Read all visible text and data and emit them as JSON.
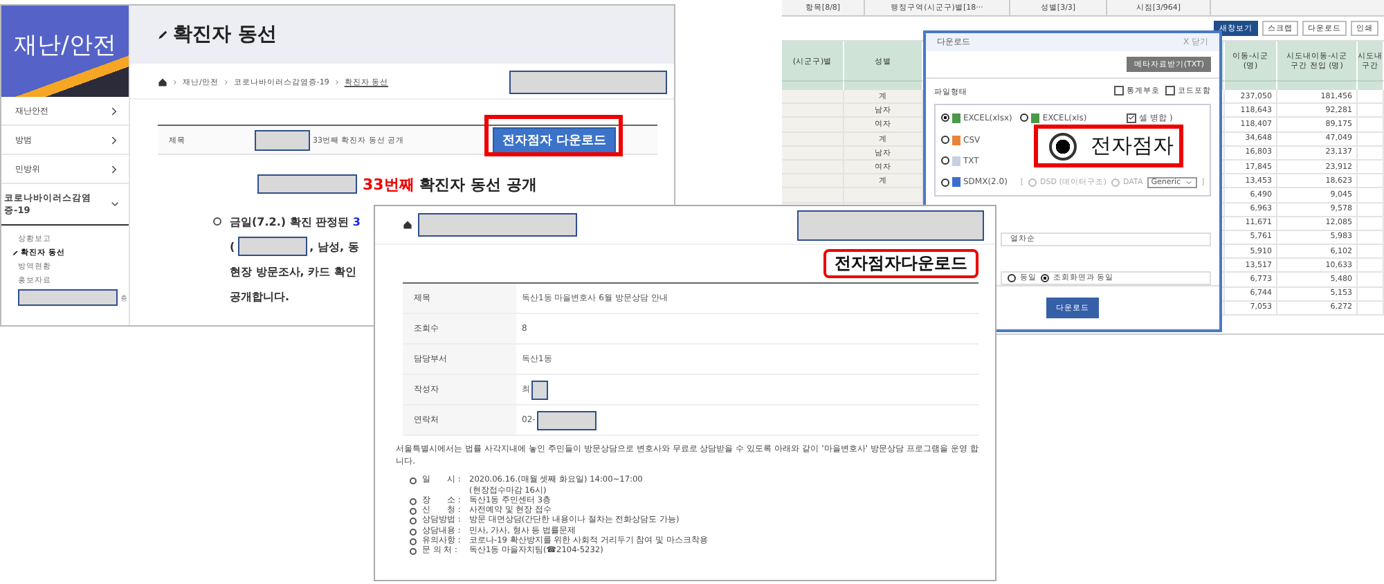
{
  "left_page": {
    "sidebar": {
      "title": "재난/안전",
      "items": [
        {
          "label": "재난안전",
          "expanded": false
        },
        {
          "label": "방범",
          "expanded": false
        },
        {
          "label": "민방위",
          "expanded": false
        },
        {
          "label": "코로나바이러스감염증-19",
          "expanded": true,
          "children": [
            {
              "kind": "link",
              "label": "상황보고",
              "selected": false
            },
            {
              "kind": "link",
              "label": "확진자 동선",
              "selected": true
            },
            {
              "kind": "link",
              "label": "방역현황",
              "selected": false
            },
            {
              "kind": "link",
              "label": "홍보자료",
              "selected": false
            },
            {
              "kind": "redacted",
              "label": "층",
              "selected": false
            }
          ]
        }
      ]
    },
    "page_title": "확진자 동선",
    "breadcrumb": [
      "재난/안전",
      "코로나바이러스감염증-19",
      "확진자 동선"
    ],
    "post": {
      "label": "제목",
      "title": "33번째 확진자 동선 공개",
      "button": "전자점자 다운로드"
    },
    "heading": {
      "highlight": "33번째",
      "text": "확진자 동선 공개"
    },
    "bullet_lines": [
      {
        "text": "금일(7.2.) 확진 판정된 ",
        "highlight": "3",
        "redacted": false
      },
      {
        "prefix": "(",
        "redacted": true,
        "text": ", 남성, 동"
      },
      {
        "text": "현장 방문조사, 카드 확인",
        "redacted": false
      },
      {
        "text": "공개합니다.",
        "redacted": false
      }
    ]
  },
  "stats_page": {
    "tabs": [
      "항목[8/8]",
      "행정구역(시군구)별[18···",
      "성별[3/3]",
      "시점[3/964]"
    ],
    "toolbar": [
      {
        "label": "새창보기",
        "primary": true
      },
      {
        "label": "스크랩",
        "primary": false
      },
      {
        "label": "다운로드",
        "primary": false
      },
      {
        "label": "인쇄",
        "primary": false
      }
    ],
    "columns": [
      "(시군구)별",
      "성별",
      "이동-시군\n(명)",
      "시도내이동-시군\n구간 전입 (명)",
      "시도내\n구간"
    ],
    "rows": [
      {
        "sex": "계",
        "a": "237,050",
        "b": "181,456"
      },
      {
        "sex": "남자",
        "a": "118,643",
        "b": "92,281"
      },
      {
        "sex": "여자",
        "a": "118,407",
        "b": "89,175"
      },
      {
        "sex": "계",
        "a": "34,648",
        "b": "47,049"
      },
      {
        "sex": "남자",
        "a": "16,803",
        "b": "23,137"
      },
      {
        "sex": "여자",
        "a": "17,845",
        "b": "23,912"
      },
      {
        "sex": "계",
        "a": "13,453",
        "b": "18,623"
      },
      {
        "a": "6,490",
        "b": "9,045"
      },
      {
        "a": "6,963",
        "b": "9,578"
      },
      {
        "a": "11,671",
        "b": "12,085"
      },
      {
        "a": "5,761",
        "b": "5,983"
      },
      {
        "a": "5,910",
        "b": "6,102"
      },
      {
        "a": "13,517",
        "b": "10,633"
      },
      {
        "a": "6,773",
        "b": "5,480"
      },
      {
        "a": "6,744",
        "b": "5,153"
      },
      {
        "a": "7,053",
        "b": "6,272"
      }
    ],
    "dialog": {
      "title": "다운로드",
      "close": "X 닫기",
      "meta_button": "메타자료받기(TXT)",
      "section": "파일형태",
      "options": [
        {
          "label": "통계부호",
          "checked": false
        },
        {
          "label": "코드포함",
          "checked": false
        }
      ],
      "formats": [
        {
          "label": "EXCEL(xlsx)",
          "kind": "excel",
          "selected": true
        },
        {
          "label": "EXCEL(xls)",
          "kind": "excel",
          "selected": false
        },
        {
          "label": "CSV",
          "kind": "csv",
          "selected": false
        },
        {
          "label": "TXT",
          "kind": "txt",
          "selected": false
        },
        {
          "label": "SDMX(2.0)",
          "kind": "sdmx",
          "selected": false
        }
      ],
      "merge": {
        "label": "셀 병합 )",
        "checked": true
      },
      "sdmx_extra": {
        "open": "[",
        "dsd": {
          "label": "DSD (데이터구조)",
          "selected": false
        },
        "data": {
          "label": "DATA",
          "selected": false
        },
        "select": "Generic",
        "close": "]"
      },
      "braille": {
        "label": "전자점자",
        "selected": true
      },
      "sort_value": "열차순",
      "order": [
        {
          "label": "동일",
          "selected": false
        },
        {
          "label": "조회화면과 동일",
          "selected": true
        }
      ],
      "download_button": "다운로드"
    }
  },
  "notice_page": {
    "banner": "전자점자다운로드",
    "fields": [
      {
        "label": "제목",
        "value": "독산1동 마을변호사 6월 방문상담 안내",
        "redacted": false
      },
      {
        "label": "조회수",
        "value": "8",
        "redacted": false
      },
      {
        "label": "담당부서",
        "value": "독산1동",
        "redacted": false
      },
      {
        "label": "작성자",
        "value": "최",
        "redacted": true
      },
      {
        "label": "연락처",
        "value": "02-",
        "redacted": true
      }
    ],
    "intro": "서울특별시에서는 법률 사각지내에 놓인 주민들이 방문상담으로 변호사와 무료로 상담받을 수 있도록 아래와 같이 '마을변호사' 방문상담 프로그램을 운영 합니다.",
    "details": [
      {
        "term": "일　　시 :",
        "value": "2020.06.16.(매월 셋째 화요일) 14:00~17:00",
        "note": "(현장접수마감 16시)"
      },
      {
        "term": "장　　소 :",
        "value": "독산1동 주민센터 3층"
      },
      {
        "term": "신　　청 :",
        "value": "사전예약 및 현장 접수"
      },
      {
        "term": "상담방법 :",
        "value": "방문 대면상담(간단한 내용이나 절차는 전화상담도 가능)"
      },
      {
        "term": "상담내용 :",
        "value": "민사, 가사, 형사 등 법률문제"
      },
      {
        "term": "유의사항 :",
        "value": "코로나-19 확산방지를 위한 사회적 거리두기 참여 및 마스크착용"
      },
      {
        "term": "문 의 처 :",
        "value": "독산1동 마을자치팀(☎2104-5232)"
      }
    ]
  }
}
